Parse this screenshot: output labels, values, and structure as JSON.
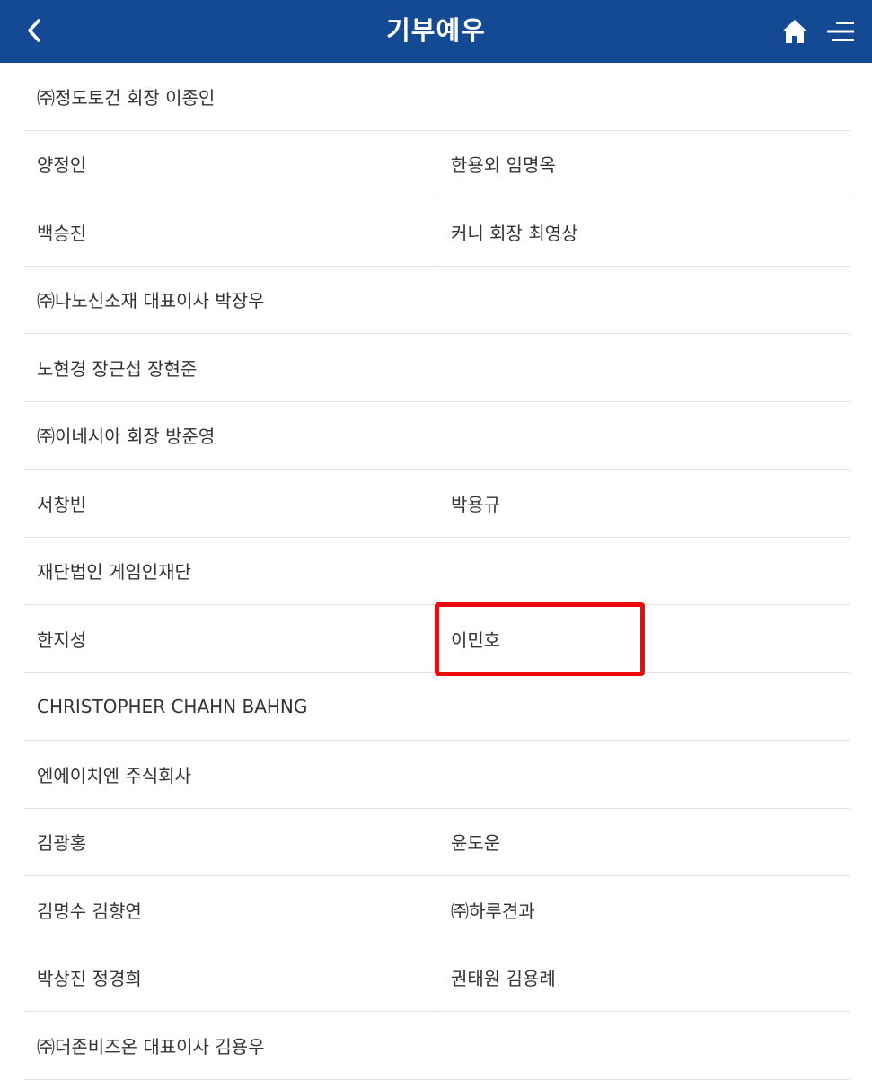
{
  "header": {
    "title": "기부예우",
    "back_icon": "chevron-left-icon",
    "home_icon": "home-icon",
    "menu_icon": "hamburger-menu-icon",
    "background_color": "#134a93"
  },
  "donors": {
    "rows": [
      {
        "type": "single",
        "cells": [
          "㈜정도토건 회장 이종인"
        ]
      },
      {
        "type": "double",
        "cells": [
          "양정인",
          "한용외 임명옥"
        ]
      },
      {
        "type": "double",
        "cells": [
          "백승진",
          "커니 회장 최영상"
        ]
      },
      {
        "type": "single",
        "cells": [
          "㈜나노신소재 대표이사 박장우"
        ]
      },
      {
        "type": "single",
        "cells": [
          " 노현경 장근섭 장현준"
        ]
      },
      {
        "type": "single",
        "cells": [
          "㈜이네시아 회장 방준영"
        ]
      },
      {
        "type": "double",
        "cells": [
          "서창빈",
          "박용규"
        ]
      },
      {
        "type": "single",
        "cells": [
          "재단법인 게임인재단"
        ]
      },
      {
        "type": "double",
        "cells": [
          "한지성",
          "이민호"
        ]
      },
      {
        "type": "single",
        "cells": [
          "CHRISTOPHER CHAHN BAHNG"
        ]
      },
      {
        "type": "single",
        "cells": [
          "엔에이치엔 주식회사"
        ]
      },
      {
        "type": "double",
        "cells": [
          "김광홍",
          "윤도운"
        ]
      },
      {
        "type": "double",
        "cells": [
          "김명수 김향연",
          "㈜하루견과"
        ]
      },
      {
        "type": "double",
        "cells": [
          "박상진 정경희",
          "권태원 김용례"
        ]
      },
      {
        "type": "single",
        "cells": [
          "㈜더존비즈온 대표이사 김용우"
        ]
      }
    ]
  },
  "highlight": {
    "color": "#ee0a0a",
    "target": "이민호"
  }
}
